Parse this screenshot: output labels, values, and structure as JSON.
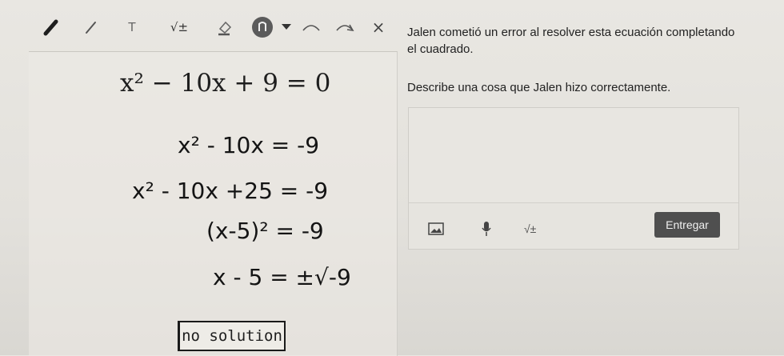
{
  "toolbar": {
    "items": [
      {
        "icon": "pen-icon"
      },
      {
        "icon": "pencil-icon"
      },
      {
        "icon": "text-tool-icon",
        "label": "T"
      },
      {
        "icon": "math-tool-icon",
        "label": "√±"
      },
      {
        "icon": "eraser-icon"
      },
      {
        "icon": "lasso-icon"
      },
      {
        "icon": "dropdown-caret-icon"
      },
      {
        "icon": "undo-icon"
      },
      {
        "icon": "redo-icon"
      },
      {
        "icon": "close-icon",
        "label": "×"
      }
    ]
  },
  "work": {
    "given_equation": "x² − 10x + 9 = 0",
    "steps": [
      "x² - 10x = -9",
      "x² - 10x +25 = -9",
      "(x-5)² = -9",
      "x - 5 = ±√-9"
    ],
    "conclusion": "no solution"
  },
  "question": {
    "text": "Jalen cometió un error al resolver esta ecuación completando el cuadrado.",
    "prompt": "Describe una cosa que Jalen hizo correctamente."
  },
  "answer": {
    "tools": [
      {
        "icon": "image-icon"
      },
      {
        "icon": "microphone-icon"
      },
      {
        "icon": "math-tool-icon",
        "label": "√±"
      }
    ],
    "submit_label": "Entregar"
  }
}
